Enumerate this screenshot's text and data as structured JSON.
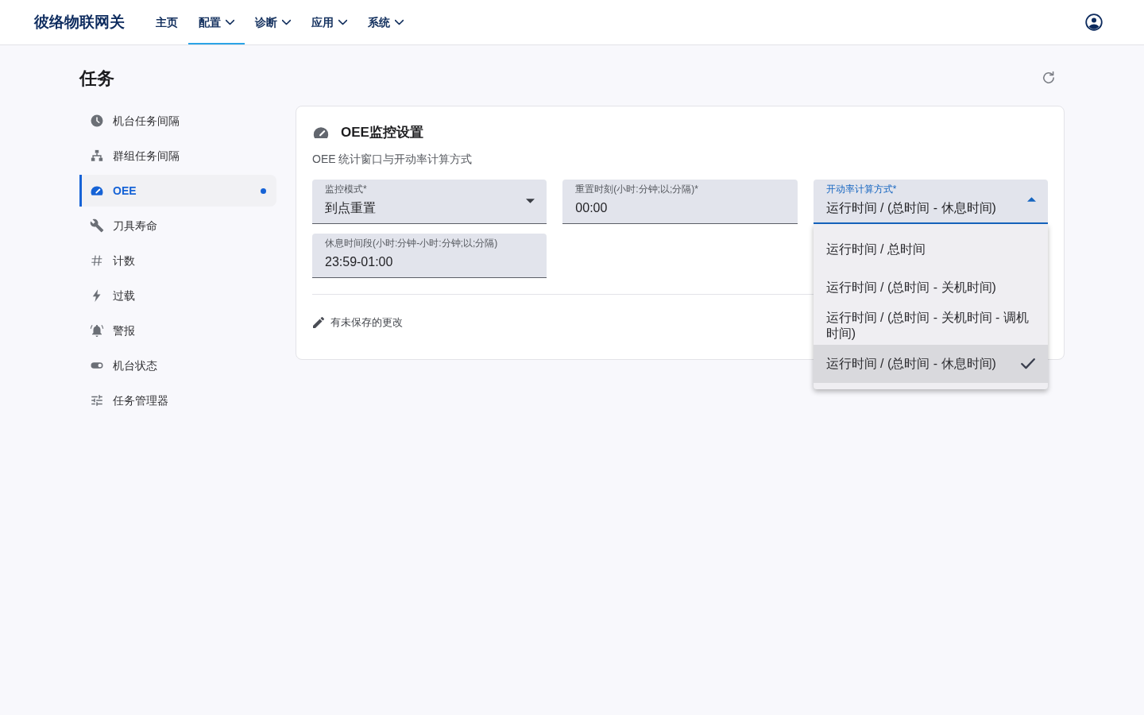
{
  "app": {
    "title": "彼络物联网关"
  },
  "nav": [
    {
      "label": "主页",
      "dropdown": false,
      "selected": false
    },
    {
      "label": "配置",
      "dropdown": true,
      "selected": true
    },
    {
      "label": "诊断",
      "dropdown": true,
      "selected": false
    },
    {
      "label": "应用",
      "dropdown": true,
      "selected": false
    },
    {
      "label": "系统",
      "dropdown": true,
      "selected": false
    }
  ],
  "page": {
    "title": "任务"
  },
  "sidebar": {
    "items": [
      {
        "label": "机台任务间隔",
        "selected": false,
        "unsaved": false
      },
      {
        "label": "群组任务间隔",
        "selected": false,
        "unsaved": false
      },
      {
        "label": "OEE",
        "selected": true,
        "unsaved": true
      },
      {
        "label": "刀具寿命",
        "selected": false,
        "unsaved": false
      },
      {
        "label": "计数",
        "selected": false,
        "unsaved": false
      },
      {
        "label": "过载",
        "selected": false,
        "unsaved": false
      },
      {
        "label": "警报",
        "selected": false,
        "unsaved": false
      },
      {
        "label": "机台状态",
        "selected": false,
        "unsaved": false
      },
      {
        "label": "任务管理器",
        "selected": false,
        "unsaved": false
      }
    ]
  },
  "card": {
    "title": "OEE监控设置",
    "subtitle": "OEE 统计窗口与开动率计算方式",
    "fields": [
      {
        "kind": "select",
        "label": "监控模式*",
        "value": "到点重置",
        "focused": false,
        "expanded": false
      },
      {
        "kind": "text",
        "label": "重置时刻(小时:分钟;以;分隔)*",
        "value": "00:00",
        "focused": false
      },
      {
        "kind": "select",
        "label": "开动率计算方式*",
        "value": "运行时间 / (总时间 - 休息时间)",
        "focused": true,
        "expanded": true,
        "options": [
          {
            "label": "运行时间 / 总时间",
            "selected": false
          },
          {
            "label": "运行时间 / (总时间 - 关机时间)",
            "selected": false
          },
          {
            "label": "运行时间 / (总时间 - 关机时间 - 调机时间)",
            "selected": false
          },
          {
            "label": "运行时间 / (总时间 - 休息时间)",
            "selected": true
          }
        ]
      },
      {
        "kind": "text",
        "label": "休息时间段(小时:分钟-小时:分钟;以;分隔)",
        "value": "23:59-01:00",
        "focused": false
      }
    ],
    "unsaved_notice": "有未保存的更改"
  }
}
